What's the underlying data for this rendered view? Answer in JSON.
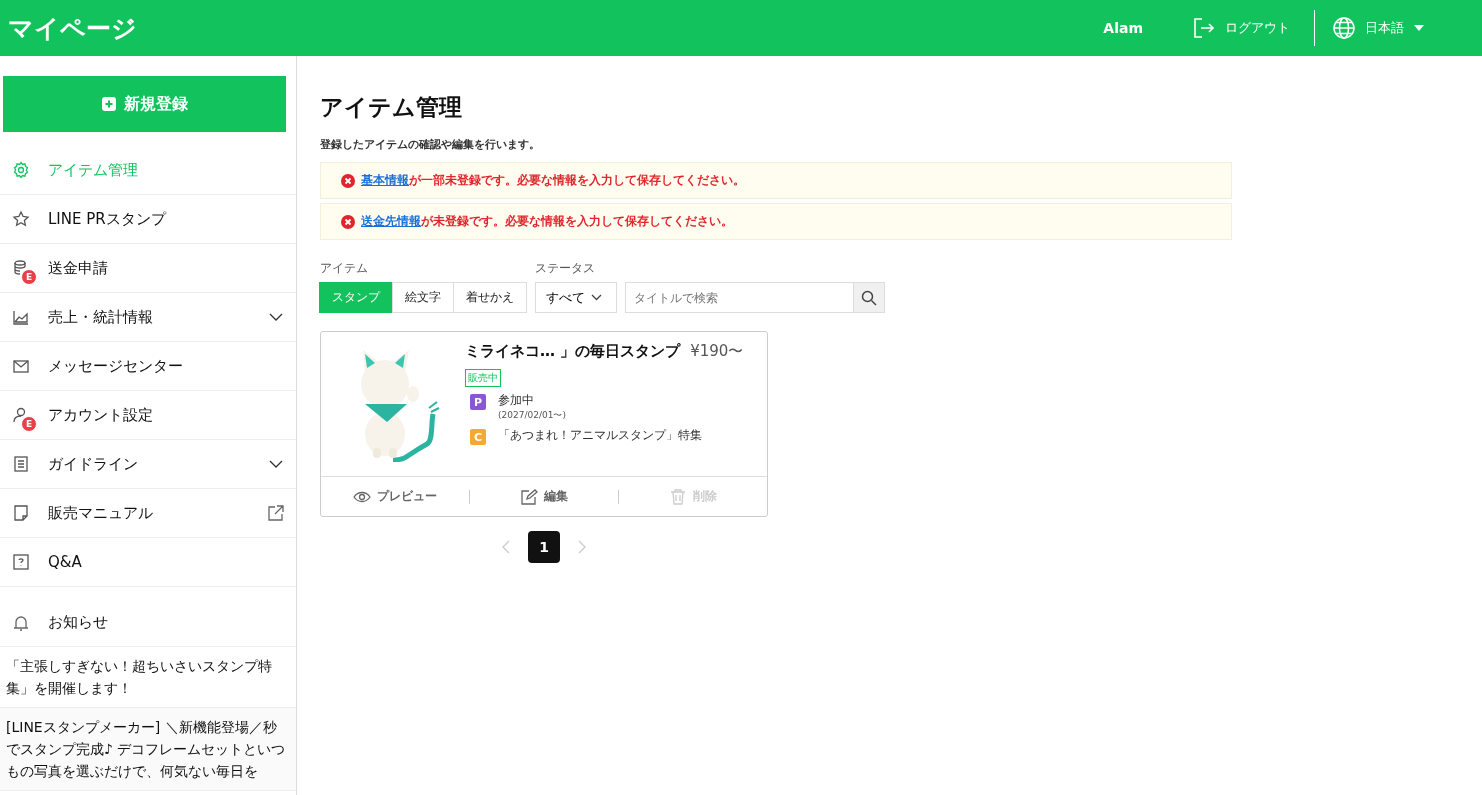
{
  "header": {
    "title": "マイページ",
    "user": "Alam",
    "logout": "ログアウト",
    "language": "日本語"
  },
  "sidebar": {
    "new_button": "新規登録",
    "items": [
      {
        "label": "アイテム管理",
        "selected": true,
        "kind": "link"
      },
      {
        "label": "LINE PRスタンプ",
        "selected": false,
        "kind": "link"
      },
      {
        "label": "送金申請",
        "selected": false,
        "kind": "link",
        "badge": "E"
      },
      {
        "label": "売上・統計情報",
        "selected": false,
        "kind": "group",
        "expanded": false
      },
      {
        "label": "メッセージセンター",
        "selected": false,
        "kind": "link"
      },
      {
        "label": "アカウント設定",
        "selected": false,
        "kind": "link",
        "badge": "E"
      },
      {
        "label": "ガイドライン",
        "selected": false,
        "kind": "group",
        "expanded": false
      },
      {
        "label": "販売マニュアル",
        "selected": false,
        "kind": "external"
      },
      {
        "label": "Q&A",
        "selected": false,
        "kind": "link"
      }
    ],
    "news_title": "お知らせ",
    "news": [
      "「主張しすぎない！超ちいさいスタンプ特集」を開催します！",
      "[LINEスタンプメーカー] ＼新機能登場／秒でスタンプ完成♪ デコフレームセットといつもの写真を選ぶだけで、何気ない毎日を"
    ]
  },
  "main": {
    "title": "アイテム管理",
    "description": "登録したアイテムの確認や編集を行います。",
    "alerts": [
      {
        "link": "基本情報",
        "text": "が一部未登録です。必要な情報を入力して保存してください。"
      },
      {
        "link": "送金先情報",
        "text": "が未登録です。必要な情報を入力して保存してください。"
      }
    ],
    "item_label": "アイテム",
    "item_tabs": [
      {
        "label": "スタンプ",
        "selected": true
      },
      {
        "label": "絵文字",
        "selected": false
      },
      {
        "label": "着せかえ",
        "selected": false
      }
    ],
    "status_label": "ステータス",
    "status_value": "すべて",
    "search": {
      "placeholder": "タイトルで検索"
    },
    "card": {
      "kind": "picture",
      "title": "ミライネコ… 」の毎日スタンプ",
      "price": "¥190〜",
      "status": "販売中",
      "campaigns": [
        {
          "badge": "P",
          "color": "#8b55d8",
          "text": "参加中",
          "sub": "(2027/02/01〜)"
        },
        {
          "badge": "C",
          "color": "#f5a833",
          "text": "「あつまれ！アニマルスタンプ」特集"
        }
      ],
      "actions": [
        {
          "label": "プレビュー",
          "disabled": false
        },
        {
          "label": "編集",
          "disabled": false
        },
        {
          "label": "削除",
          "disabled": true
        }
      ]
    },
    "pagination": {
      "prev_disabled": true,
      "pages": [
        {
          "label": "1",
          "selected": true
        }
      ],
      "next_disabled": true
    }
  }
}
